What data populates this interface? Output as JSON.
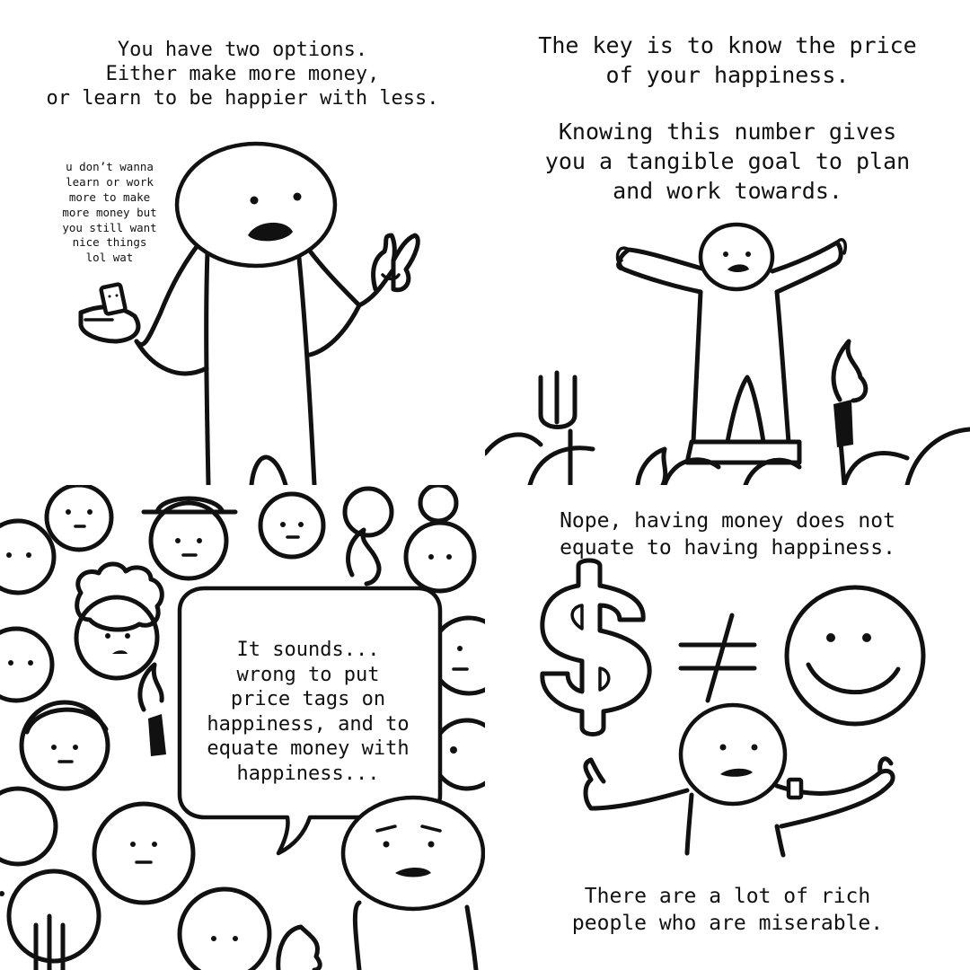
{
  "panels": {
    "top_left": {
      "caption": "You have two options.\nEither make more money,\nor learn to be happier with less.",
      "aside": "u don’t wanna\nlearn or work\nmore to make\nmore money but\nyou still want\nnice things\nlol wat"
    },
    "top_right": {
      "caption_1": "The key is to know the price\nof your happiness.",
      "caption_2": "Knowing this number gives\nyou a tangible goal to plan\nand work towards."
    },
    "bottom_left": {
      "speech": "It sounds...\nwrong to put\nprice tags on\nhappiness, and to\nequate money with\nhappiness..."
    },
    "bottom_right": {
      "caption_top": "Nope, having money does not\nequate to having happiness.",
      "caption_bottom": "There are a lot of rich\npeople who are miserable."
    }
  },
  "colors": {
    "ink": "#111111",
    "paper": "#ffffff"
  }
}
